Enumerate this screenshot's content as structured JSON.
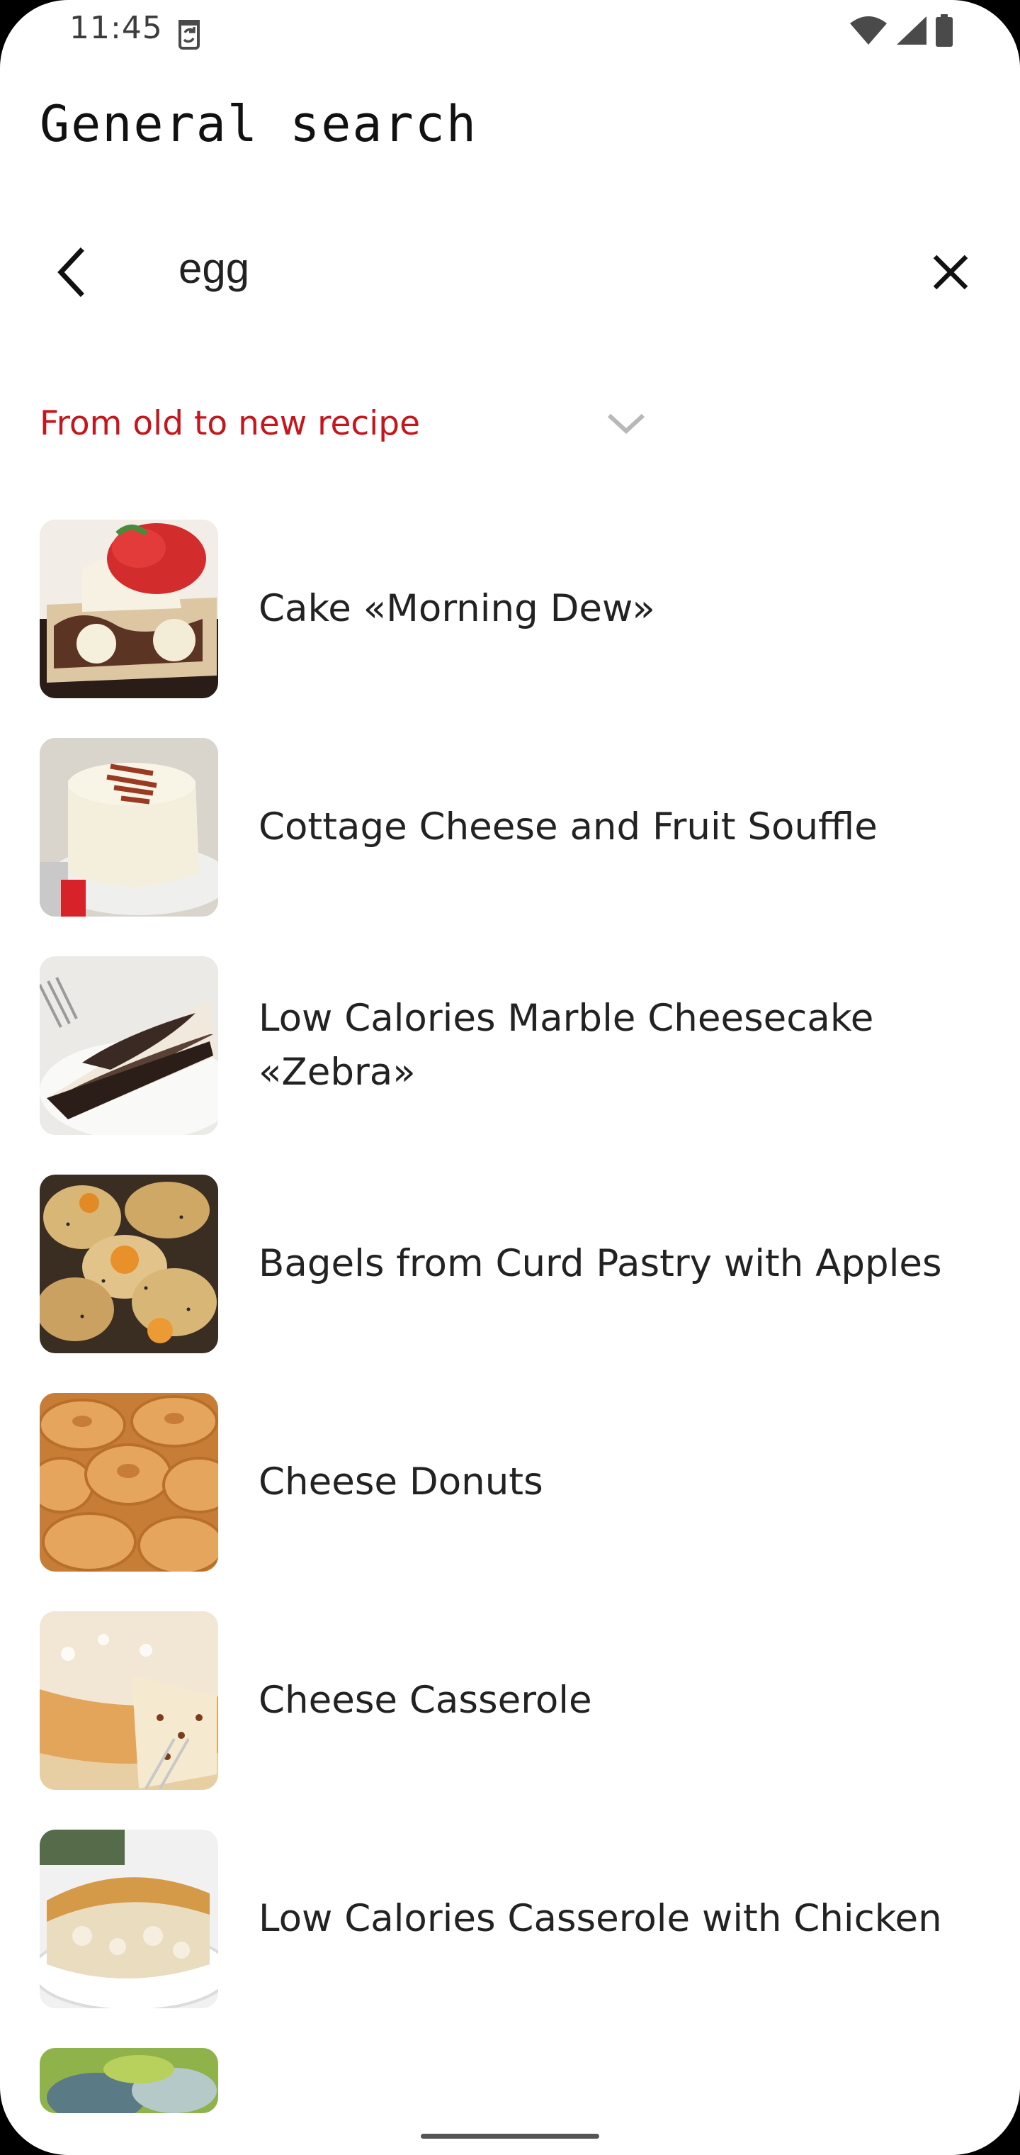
{
  "status_bar": {
    "time": "11:45",
    "app_icon": "storage-sync-icon",
    "wifi_icon": "wifi-icon",
    "signal_icon": "cell-signal-icon",
    "battery_icon": "battery-icon"
  },
  "header": {
    "title": "General search"
  },
  "search": {
    "query": "egg",
    "back_icon": "back-arrow-icon",
    "clear_icon": "close-icon"
  },
  "sort": {
    "selected": "From old to new recipe",
    "accent_color": "#c4161c"
  },
  "recipes": [
    {
      "name": "Cake «Morning Dew»"
    },
    {
      "name": "Cottage Cheese and Fruit Souffle"
    },
    {
      "name": "Low Calories Marble Cheesecake «Zebra»"
    },
    {
      "name": "Bagels from Curd Pastry with Apples"
    },
    {
      "name": "Cheese Donuts"
    },
    {
      "name": "Cheese Casserole"
    },
    {
      "name": "Low Calories Casserole with Chicken"
    },
    {
      "name": ""
    }
  ]
}
